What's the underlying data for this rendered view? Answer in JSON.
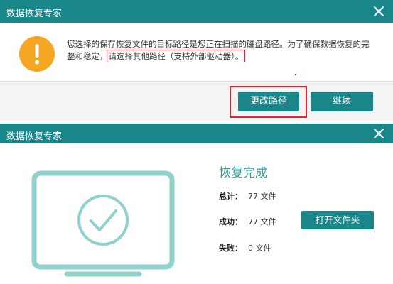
{
  "colors": {
    "accent": "#19868a",
    "warning": "#f5a623",
    "highlight_border": "#e0282c",
    "result_title": "#2a9e98"
  },
  "dialog_top": {
    "title": "数据恢复专家",
    "icons": {
      "warning": "exclamation-icon",
      "close": "close-icon"
    },
    "message_line1": "您选择的保存恢复文件的目标路径是您正在扫描的磁盘路径。为了确保数据恢复的完",
    "message_line2_prefix": "整和稳定，",
    "message_line2_highlight": "请选择其他路径（支持外部驱动器）。",
    "buttons": {
      "change_path": "更改路径",
      "continue": "继续"
    }
  },
  "dialog_bottom": {
    "title": "数据恢复专家",
    "icons": {
      "close": "close-icon",
      "monitor": "monitor-check-icon"
    },
    "result_title": "恢复完成",
    "stats": {
      "total_label": "总计：",
      "total_value": "77 文件",
      "success_label": "成功：",
      "success_value": "77 文件",
      "fail_label": "失败：",
      "fail_value": "0 文件"
    },
    "buttons": {
      "open_folder": "打开文件夹"
    }
  }
}
